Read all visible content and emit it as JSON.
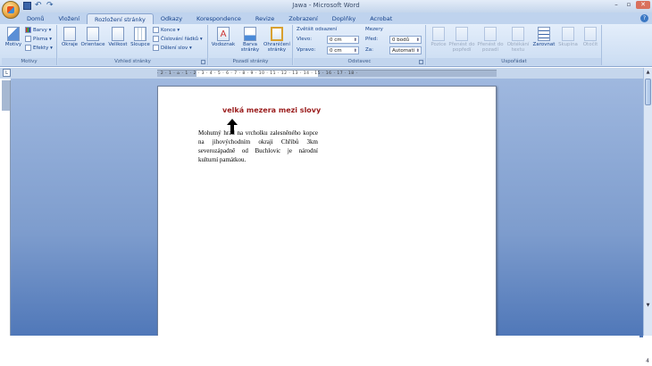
{
  "window": {
    "title": "Jawa - Microsoft Word",
    "controls": [
      "–",
      "▫",
      "✕"
    ]
  },
  "tabs": [
    "Domů",
    "Vložení",
    "Rozložení stránky",
    "Odkazy",
    "Korespondence",
    "Revize",
    "Zobrazení",
    "Doplňky",
    "Acrobat"
  ],
  "active_tab": "Rozložení stránky",
  "ribbon": {
    "motivy": {
      "label": "Motivy",
      "big": "Motivy",
      "items": [
        "Barvy",
        "Písma",
        "Efekty"
      ]
    },
    "vzhled": {
      "label": "Vzhled stránky",
      "buttons": [
        "Okraje",
        "Orientace",
        "Velikost",
        "Sloupce"
      ],
      "small": [
        "Konce",
        "Číslování řádků",
        "Dělení slov"
      ]
    },
    "pozadi": {
      "label": "Pozadí stránky",
      "buttons": [
        "Vodoznak",
        "Barva stránky",
        "Ohraničení stránky"
      ]
    },
    "odstavec": {
      "label": "Odstavec",
      "indent_title": "Zvětšit odsazení",
      "left_label": "Vlevo:",
      "left_value": "0 cm",
      "right_label": "Vpravo:",
      "right_value": "0 cm",
      "spacing_title": "Mezery",
      "before_label": "Před:",
      "before_value": "0 bodů",
      "after_label": "Za:",
      "after_value": "Automati"
    },
    "usporadat": {
      "label": "Uspořádat",
      "buttons": [
        "Pozice",
        "Přenést do popředí",
        "Přenést do pozadí",
        "Obtékání textu",
        "Zarovnat",
        "Skupina",
        "Otočit"
      ]
    }
  },
  "ruler": {
    "marks": "· 2 · 1 · ⌂ · 1 · 2 · 3 · 4 · 5 · 6 · 7 · 8 · 9 · 10 · 11 · 12 · 13 · 14 · 15 · 16 · 17 · 18 ·"
  },
  "document": {
    "annotation": "velká mezera mezi slovy",
    "paragraph": "Mohutný hrad na vrcholku zalesněného kopce na jihovýchodním okraji Chřibů 3km severozápadně od Buchlovic je národní kulturní památkou."
  },
  "status": {
    "page_fragment": "4"
  }
}
